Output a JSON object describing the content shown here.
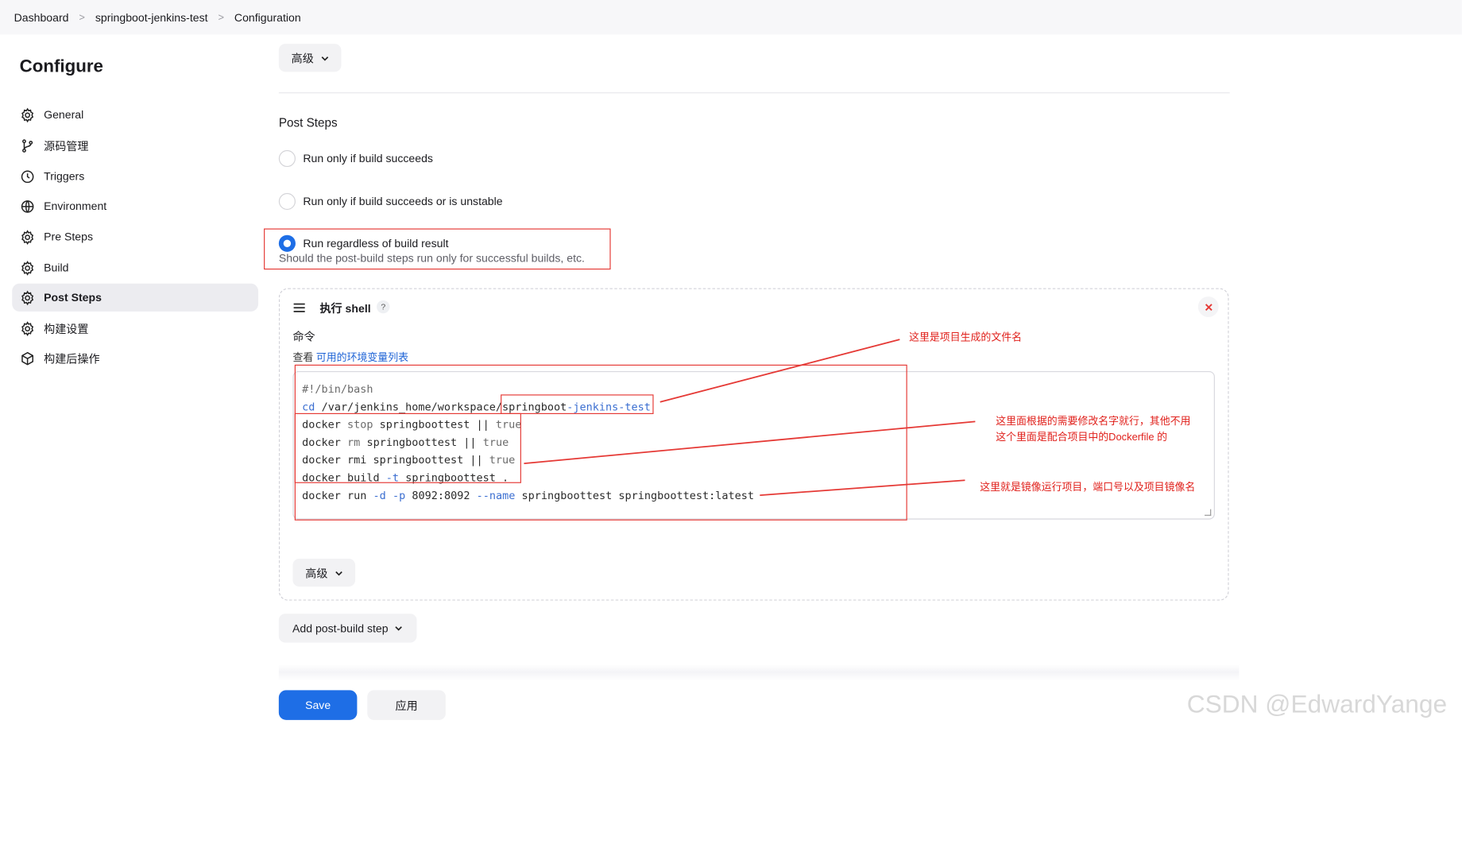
{
  "breadcrumb": {
    "items": [
      "Dashboard",
      "springboot-jenkins-test",
      "Configuration"
    ]
  },
  "sidebar": {
    "title": "Configure",
    "items": [
      {
        "label": "General",
        "icon": "gear-icon"
      },
      {
        "label": "源码管理",
        "icon": "branch-icon"
      },
      {
        "label": "Triggers",
        "icon": "clock-icon"
      },
      {
        "label": "Environment",
        "icon": "globe-icon"
      },
      {
        "label": "Pre Steps",
        "icon": "gear-icon"
      },
      {
        "label": "Build",
        "icon": "gear-icon"
      },
      {
        "label": "Post Steps",
        "icon": "gear-icon",
        "active": true
      },
      {
        "label": "构建设置",
        "icon": "gear-icon"
      },
      {
        "label": "构建后操作",
        "icon": "package-icon"
      }
    ]
  },
  "main": {
    "advanced_top": "高级",
    "post_steps": {
      "title": "Post Steps",
      "options": [
        {
          "label": "Run only if build succeeds",
          "checked": false
        },
        {
          "label": "Run only if build succeeds or is unstable",
          "checked": false
        },
        {
          "label": "Run regardless of build result",
          "checked": true
        }
      ],
      "hint": "Should the post-build steps run only for successful builds, etc."
    },
    "shell_step": {
      "title": "执行 shell",
      "help": "?",
      "command_label": "命令",
      "env_prefix": "查看 ",
      "env_link": "可用的环境变量列表",
      "advanced": "高级"
    },
    "add_step": "Add post-build step",
    "save": "Save",
    "apply": "应用"
  },
  "code": [
    "#!/bin/bash",
    "cd /var/jenkins_home/workspace/springboot-jenkins-test",
    "docker stop springboottest || true",
    "docker rm springboottest || true",
    "docker rmi springboottest || true",
    "docker build -t springboottest .",
    "docker run -d -p 8092:8092 --name springboottest springboottest:latest"
  ],
  "annotations": {
    "a1": "这里是项目生成的文件名",
    "a2_line1": "这里面根据的需要修改名字就行，其他不用",
    "a2_line2": "这个里面是配合项目中的Dockerfile 的",
    "a3": "这里就是镜像运行项目，端口号以及项目镜像名"
  },
  "watermark": "CSDN @EdwardYange",
  "colors": {
    "accent": "#1e6ee6",
    "annotation": "#e0201b",
    "link": "#1e63d6"
  }
}
